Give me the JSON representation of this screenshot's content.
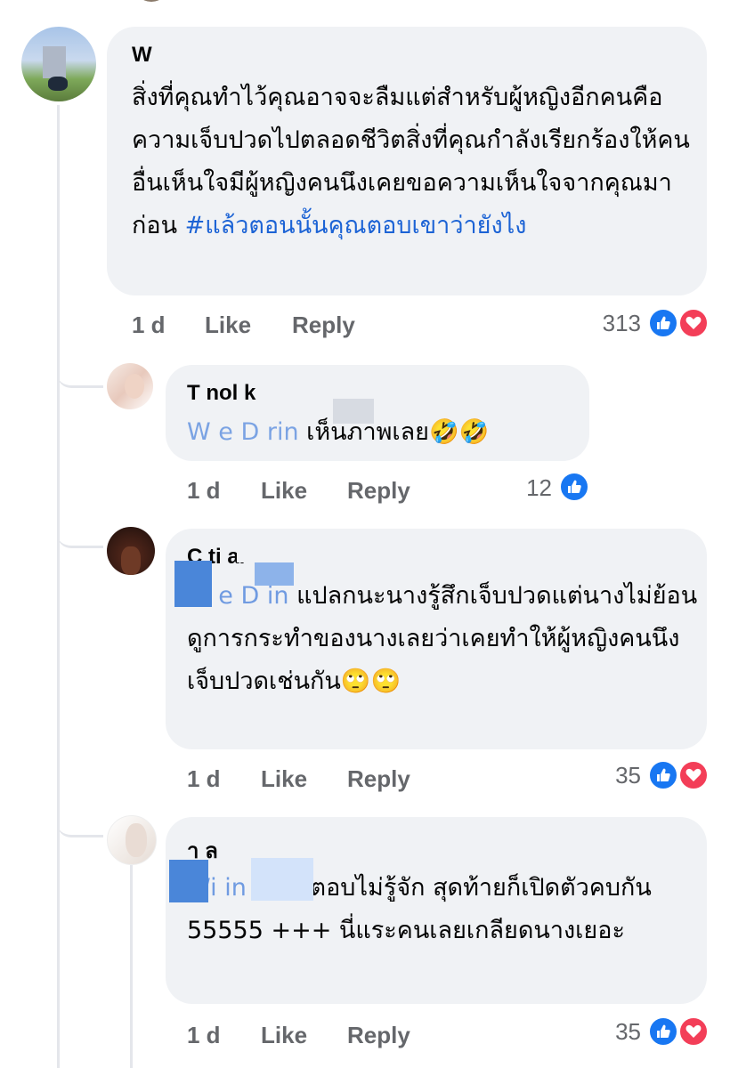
{
  "comments": [
    {
      "author": "W      D",
      "text": "สิ่งที่คุณทำไว้คุณอาจจะลืมแต่สำหรับผู้หญิงอีกคนคือความเจ็บปวดไปตลอดชีวิตสิ่งที่คุณกำลังเรียกร้องให้คนอื่นเห็นใจมีผู้หญิงคนนึงเคยขอความเห็นใจจากคุณมาก่อน",
      "hashtag": "#แล้วตอนนั้นคุณตอบเขาว่ายังไง",
      "time": "1 d",
      "like_label": "Like",
      "reply_label": "Reply",
      "reaction_count": "313",
      "reactions": [
        "like",
        "love"
      ]
    }
  ],
  "replies": [
    {
      "author": "T            nol   k",
      "mention": "W    e D  rin",
      "text": "เห็นภาพเลย🤣🤣",
      "time": "1 d",
      "like_label": "Like",
      "reply_label": "Reply",
      "reaction_count": "12",
      "reactions": [
        "like"
      ]
    },
    {
      "author": "C  ti                     al",
      "mention": "W   e D   in",
      "text": "แปลกนะนางรู้สึกเจ็บปวดแต่นางไม่ย้อนดูการกระทำของนางเลยว่าเคยทำให้ผู้หญิงคนนึงเจ็บปวดเช่นกัน🙄🙄",
      "time": "1 d",
      "like_label": "Like",
      "reply_label": "Reply",
      "reaction_count": "35",
      "reactions": [
        "like",
        "love"
      ]
    },
    {
      "author": "   า   ล",
      "mention": "Wi         in",
      "text": "นางก็ตอบไม่รู้จัก สุดท้ายก็เปิดตัวคบกัน 55555 +++ นี่แระคนเลยเกลียดนางเยอะ",
      "time": "1 d",
      "like_label": "Like",
      "reply_label": "Reply",
      "reaction_count": "35",
      "reactions": [
        "like",
        "love"
      ]
    }
  ],
  "colors": {
    "like_blue": "#1877f2",
    "love_red": "#f33e58",
    "bubble_bg": "#f0f2f5",
    "meta_gray": "#65676b",
    "link_blue": "#1c63d5"
  }
}
